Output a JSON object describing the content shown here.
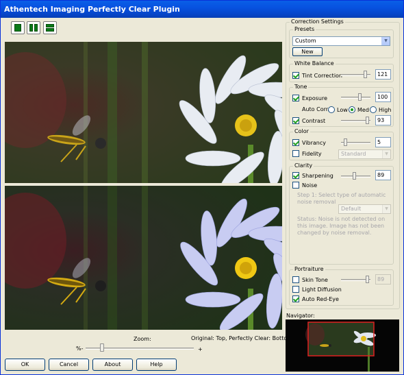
{
  "window": {
    "title": "Athentech Imaging Perfectly Clear Plugin"
  },
  "toolbar": {
    "views": [
      "single-view-icon",
      "side-by-side-view-icon",
      "top-bottom-view-icon"
    ]
  },
  "zoom": {
    "label": "Zoom:",
    "minus": "%-",
    "plus": "+",
    "level": 0.15
  },
  "compare_label": "Original: Top, Perfectly Clear: Bottom",
  "buttons": {
    "ok": "OK",
    "cancel": "Cancel",
    "about": "About",
    "help": "Help"
  },
  "settings": {
    "title": "Correction Settings",
    "presets": {
      "title": "Presets",
      "value": "Custom",
      "new_label": "New"
    },
    "white_balance": {
      "title": "White Balance",
      "tint_label": "Tint Correction",
      "tint_checked": true,
      "tint_value": "121"
    },
    "tone": {
      "title": "Tone",
      "exposure_label": "Exposure",
      "exposure_checked": true,
      "exposure_value": "100",
      "autocorr_label": "Auto Corr.",
      "low": "Low",
      "med": "Med",
      "high": "High",
      "autocorr_selected": "Med",
      "contrast_label": "Contrast",
      "contrast_checked": true,
      "contrast_value": "93"
    },
    "color": {
      "title": "Color",
      "vibrancy_label": "Vibrancy",
      "vibrancy_checked": true,
      "vibrancy_value": "5",
      "fidelity_label": "Fidelity",
      "fidelity_checked": false,
      "fidelity_option": "Standard"
    },
    "clarity": {
      "title": "Clarity",
      "sharpening_label": "Sharpening",
      "sharpening_checked": true,
      "sharpening_value": "89",
      "noise_label": "Noise",
      "noise_checked": false,
      "step1": "Step 1: Select type of automatic noise removal",
      "noise_option": "Default",
      "status": "Status: Noise is not detected on this image. Image has not been changed by noise removal."
    },
    "portraiture": {
      "title": "Portraiture",
      "skin_label": "Skin Tone",
      "skin_checked": false,
      "skin_value": "89",
      "diffusion_label": "Light Diffusion",
      "diffusion_checked": false,
      "redeye_label": "Auto Red-Eye",
      "redeye_checked": true
    }
  },
  "navigator": {
    "label": "Navigator:"
  },
  "colors": {
    "accent": "#0752e0",
    "check": "#21a121",
    "nav_frame": "#e02020"
  }
}
